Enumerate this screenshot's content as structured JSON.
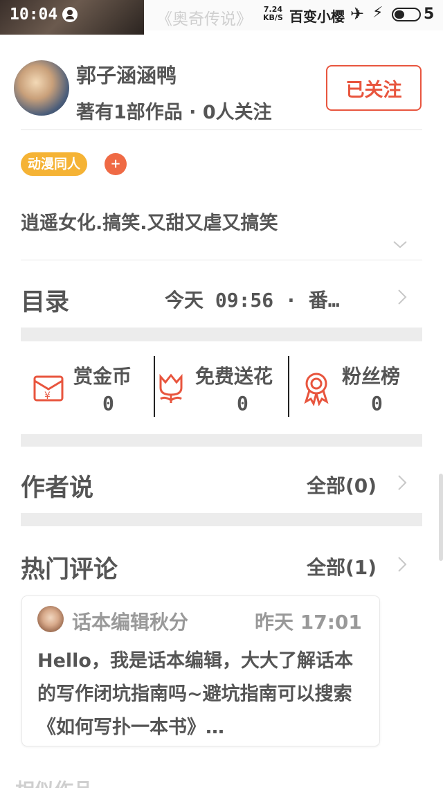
{
  "status_bar": {
    "time": "10:04",
    "bg_title": "《奥奇传说》",
    "net_speed_value": "7.24",
    "net_speed_unit": "KB/S",
    "app_name": "百变小樱",
    "battery": "5"
  },
  "author": {
    "name": "郭子涵涵鸭",
    "meta": "著有1部作品 · 0人关注",
    "follow_label": "已关注"
  },
  "book": {
    "tags": [
      "动漫同人"
    ],
    "tag_add": "+",
    "summary": "逍遥女化.搞笑.又甜又虐又搞笑"
  },
  "catalog": {
    "title": "目录",
    "update": "今天 09:56 · 番…"
  },
  "stats": [
    {
      "label": "赏金币",
      "value": "0",
      "icon": "red-envelope-icon"
    },
    {
      "label": "免费送花",
      "value": "0",
      "icon": "flower-icon"
    },
    {
      "label": "粉丝榜",
      "value": "0",
      "icon": "medal-icon"
    }
  ],
  "author_says": {
    "title": "作者说",
    "link": "全部(0)"
  },
  "hot_comments": {
    "title": "热门评论",
    "link": "全部(1)",
    "items": [
      {
        "user": "话本编辑秋分",
        "time": "昨天 17:01",
        "text": "Hello，我是话本编辑，大大了解话本的写作闭坑指南吗~避坑指南可以搜索《如何写扑一本书》…"
      }
    ]
  },
  "bottom_peek": "相似作品",
  "colors": {
    "accent": "#e8553e",
    "tag": "#f5b335",
    "tag_add": "#ef6a45",
    "band": "#ececec"
  }
}
